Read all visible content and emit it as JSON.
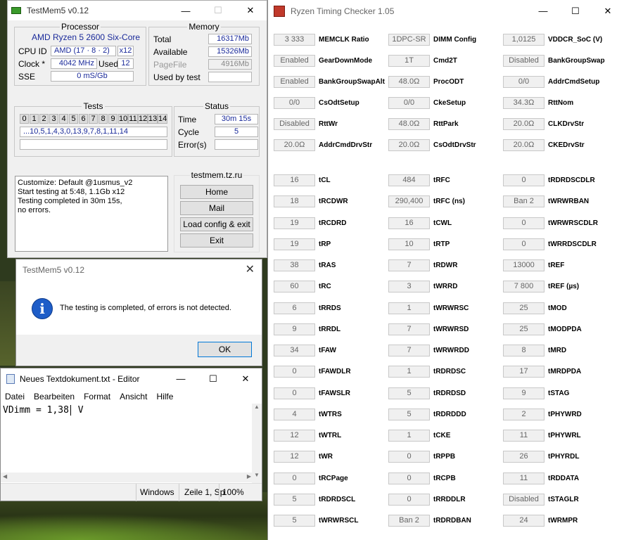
{
  "testmem": {
    "title": "TestMem5 v0.12",
    "processor": {
      "group": "Processor",
      "name": "AMD Ryzen 5 2600 Six-Core",
      "cpuid_label": "CPU ID",
      "cpuid": "AMD  (17 · 8 · 2)",
      "threads": "x12",
      "clock_label": "Clock *",
      "clock": "4042 MHz",
      "used_label": "Used",
      "used": "12",
      "sse_label": "SSE",
      "sse": "0 mS/Gb"
    },
    "memory": {
      "group": "Memory",
      "total_label": "Total",
      "total": "16317Mb",
      "available_label": "Available",
      "available": "15326Mb",
      "pagefile_label": "PageFile",
      "pagefile": "4916Mb",
      "usedby_label": "Used by test"
    },
    "tests": {
      "group": "Tests",
      "cells": [
        "0",
        "1",
        "2",
        "3",
        "4",
        "5",
        "6",
        "7",
        "8",
        "9",
        "10",
        "11",
        "12",
        "13",
        "14"
      ],
      "sequence": "...10,5,1,4,3,0,13,9,7,8,1,11,14"
    },
    "status": {
      "group": "Status",
      "time_label": "Time",
      "time": "30m 15s",
      "cycle_label": "Cycle",
      "cycle": "5",
      "errors_label": "Error(s)",
      "errors": ""
    },
    "log": [
      "Customize: Default @1usmus_v2",
      "Start testing at 5:48, 1.1Gb x12",
      "Testing completed in 30m 15s,",
      "no errors."
    ],
    "site": {
      "group": "testmem.tz.ru",
      "home": "Home",
      "mail": "Mail",
      "load": "Load config & exit",
      "exit": "Exit"
    }
  },
  "dialog": {
    "title": "TestMem5 v0.12",
    "message": "The testing is completed, of errors is not detected.",
    "ok": "OK"
  },
  "notepad": {
    "title": "Neues Textdokument.txt - Editor",
    "menu": [
      "Datei",
      "Bearbeiten",
      "Format",
      "Ansicht",
      "Hilfe"
    ],
    "content_before": "VDimm = 1,38",
    "content_after": " V",
    "status_eol": "Windows",
    "status_pos": "Zeile 1, Sp",
    "status_zoom": "100%"
  },
  "rtc": {
    "title": "Ryzen Timing Checker 1.05",
    "top_rows": [
      [
        {
          "v": "3 333",
          "l": "MEMCLK Ratio"
        },
        {
          "v": "1DPC-SR",
          "l": "DIMM Config"
        },
        {
          "v": "1,0125",
          "l": "VDDCR_SoC (V)"
        }
      ],
      [
        {
          "v": "Enabled",
          "l": "GearDownMode"
        },
        {
          "v": "1T",
          "l": "Cmd2T"
        },
        {
          "v": "Disabled",
          "l": "BankGroupSwap"
        }
      ],
      [
        {
          "v": "Enabled",
          "l": "BankGroupSwapAlt"
        },
        {
          "v": "48.0Ω",
          "l": "ProcODT"
        },
        {
          "v": "0/0",
          "l": "AddrCmdSetup"
        }
      ],
      [
        {
          "v": "0/0",
          "l": "CsOdtSetup"
        },
        {
          "v": "0/0",
          "l": "CkeSetup"
        },
        {
          "v": "34.3Ω",
          "l": "RttNom"
        }
      ],
      [
        {
          "v": "Disabled",
          "l": "RttWr"
        },
        {
          "v": "48.0Ω",
          "l": "RttPark"
        },
        {
          "v": "20.0Ω",
          "l": "CLKDrvStr"
        }
      ],
      [
        {
          "v": "20.0Ω",
          "l": "AddrCmdDrvStr"
        },
        {
          "v": "20.0Ω",
          "l": "CsOdtDrvStr"
        },
        {
          "v": "20.0Ω",
          "l": "CKEDrvStr"
        }
      ]
    ],
    "timing_rows": [
      [
        {
          "v": "16",
          "l": "tCL"
        },
        {
          "v": "484",
          "l": "tRFC"
        },
        {
          "v": "0",
          "l": "tRDRDSCDLR"
        }
      ],
      [
        {
          "v": "18",
          "l": "tRCDWR"
        },
        {
          "v": "290,400",
          "l": "tRFC (ns)"
        },
        {
          "v": "Ban 2",
          "l": "tWRWRBAN"
        }
      ],
      [
        {
          "v": "19",
          "l": "tRCDRD"
        },
        {
          "v": "16",
          "l": "tCWL"
        },
        {
          "v": "0",
          "l": "tWRWRSCDLR"
        }
      ],
      [
        {
          "v": "19",
          "l": "tRP"
        },
        {
          "v": "10",
          "l": "tRTP"
        },
        {
          "v": "0",
          "l": "tWRRDSCDLR"
        }
      ],
      [
        {
          "v": "38",
          "l": "tRAS"
        },
        {
          "v": "7",
          "l": "tRDWR"
        },
        {
          "v": "13000",
          "l": "tREF"
        }
      ],
      [
        {
          "v": "60",
          "l": "tRC"
        },
        {
          "v": "3",
          "l": "tWRRD"
        },
        {
          "v": "7 800",
          "l": "tREF (µs)"
        }
      ],
      [
        {
          "v": "6",
          "l": "tRRDS"
        },
        {
          "v": "1",
          "l": "tWRWRSC"
        },
        {
          "v": "25",
          "l": "tMOD"
        }
      ],
      [
        {
          "v": "9",
          "l": "tRRDL"
        },
        {
          "v": "7",
          "l": "tWRWRSD"
        },
        {
          "v": "25",
          "l": "tMODPDA"
        }
      ],
      [
        {
          "v": "34",
          "l": "tFAW"
        },
        {
          "v": "7",
          "l": "tWRWRDD"
        },
        {
          "v": "8",
          "l": "tMRD"
        }
      ],
      [
        {
          "v": "0",
          "l": "tFAWDLR"
        },
        {
          "v": "1",
          "l": "tRDRDSC"
        },
        {
          "v": "17",
          "l": "tMRDPDA"
        }
      ],
      [
        {
          "v": "0",
          "l": "tFAWSLR"
        },
        {
          "v": "5",
          "l": "tRDRDSD"
        },
        {
          "v": "9",
          "l": "tSTAG"
        }
      ],
      [
        {
          "v": "4",
          "l": "tWTRS"
        },
        {
          "v": "5",
          "l": "tRDRDDD"
        },
        {
          "v": "2",
          "l": "tPHYWRD"
        }
      ],
      [
        {
          "v": "12",
          "l": "tWTRL"
        },
        {
          "v": "1",
          "l": "tCKE"
        },
        {
          "v": "11",
          "l": "tPHYWRL"
        }
      ],
      [
        {
          "v": "12",
          "l": "tWR"
        },
        {
          "v": "0",
          "l": "tRPPB"
        },
        {
          "v": "26",
          "l": "tPHYRDL"
        }
      ],
      [
        {
          "v": "0",
          "l": "tRCPage"
        },
        {
          "v": "0",
          "l": "tRCPB"
        },
        {
          "v": "11",
          "l": "tRDDATA"
        }
      ],
      [
        {
          "v": "5",
          "l": "tRDRDSCL"
        },
        {
          "v": "0",
          "l": "tRRDDLR"
        },
        {
          "v": "Disabled",
          "l": "tSTAGLR"
        }
      ],
      [
        {
          "v": "5",
          "l": "tWRWRSCL"
        },
        {
          "v": "Ban 2",
          "l": "tRDRDBAN"
        },
        {
          "v": "24",
          "l": "tWRMPR"
        }
      ]
    ]
  }
}
